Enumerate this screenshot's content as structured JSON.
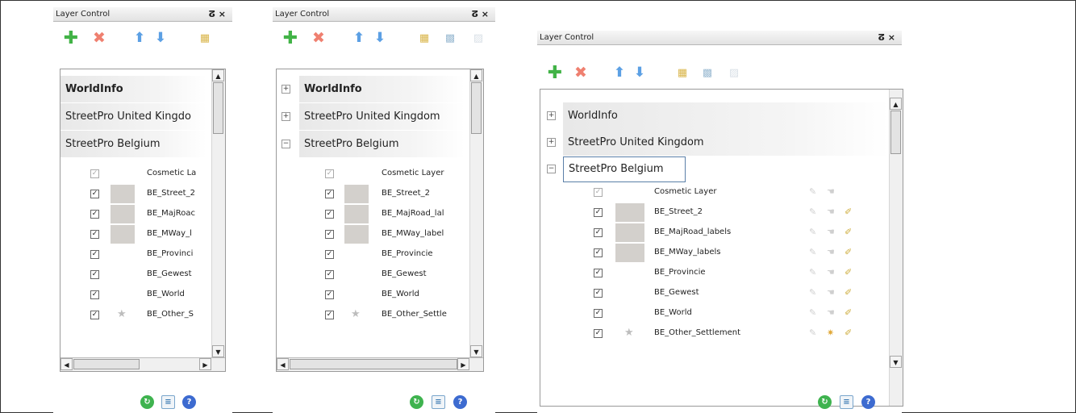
{
  "window_title": "Layer Control",
  "title_buttons": [
    "Ť",
    "×"
  ],
  "toolbar_icons": [
    "add-layer-icon",
    "remove-layer-icon",
    "move-up-icon",
    "move-down-icon",
    "layer-properties-icon",
    "label-settings-icon",
    "style-override-icon"
  ],
  "groups": [
    {
      "name": "WorldInfo",
      "bold": true
    },
    {
      "name": "StreetPro United Kingdom",
      "bold": false
    },
    {
      "name": "StreetPro Belgium",
      "bold": false
    }
  ],
  "layers": [
    {
      "name": "Cosmetic Layer",
      "checked": true,
      "disabled": true
    },
    {
      "name": "BE_Street_2",
      "checked": true
    },
    {
      "name": "BE_MajRoad_labels",
      "checked": true
    },
    {
      "name": "BE_MWay_labels",
      "checked": true
    },
    {
      "name": "BE_Provincie",
      "checked": true
    },
    {
      "name": "BE_Gewest",
      "checked": true
    },
    {
      "name": "BE_World",
      "checked": true
    },
    {
      "name": "BE_Other_Settlement",
      "checked": true
    }
  ],
  "panel1": {
    "groups": [
      "WorldInfo",
      "StreetPro United Kingdo",
      "StreetPro Belgium"
    ],
    "layers": [
      "Cosmetic La",
      "BE_Street_2",
      "BE_MajRoac",
      "BE_MWay_l",
      "BE_Provinci",
      "BE_Gewest",
      "BE_World",
      "BE_Other_S"
    ]
  },
  "panel2": {
    "groups": [
      "WorldInfo",
      "StreetPro United Kingdom",
      "StreetPro Belgium"
    ],
    "layers": [
      "Cosmetic Layer",
      "BE_Street_2",
      "BE_MajRoad_lal",
      "BE_MWay_label",
      "BE_Provincie",
      "BE_Gewest",
      "BE_World",
      "BE_Other_Settle"
    ]
  },
  "panel3": {
    "groups": [
      "WorldInfo",
      "StreetPro United Kingdom",
      "StreetPro Belgium"
    ],
    "layers": [
      "Cosmetic Layer",
      "BE_Street_2",
      "BE_MajRoad_labels",
      "BE_MWay_labels",
      "BE_Provincie",
      "BE_Gewest",
      "BE_World",
      "BE_Other_Settlement"
    ]
  },
  "bottom_icons": [
    "ok-icon",
    "list-icon",
    "help-icon"
  ]
}
